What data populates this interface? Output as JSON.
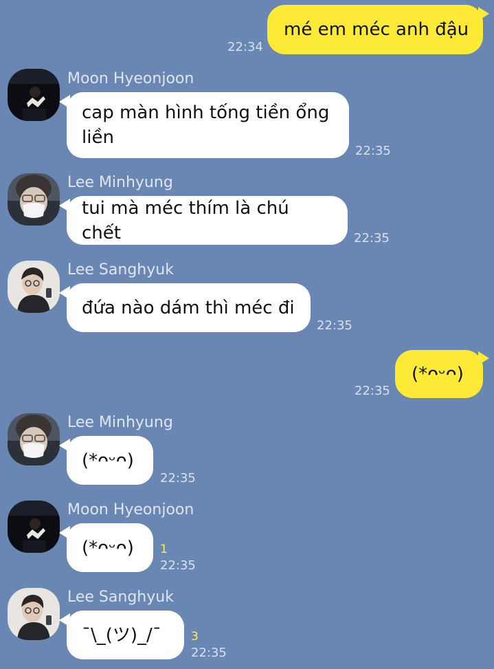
{
  "messages": [
    {
      "direction": "out",
      "text": "mé em méc anh đậu",
      "time": "22:34"
    },
    {
      "direction": "in",
      "sender": "Moon Hyeonjoon",
      "avatar": "avatar-moon-hyeonjoon",
      "text": "cap màn hình tống tiền ổng liền",
      "time": "22:35"
    },
    {
      "direction": "in",
      "sender": "Lee Minhyung",
      "avatar": "avatar-lee-minhyung",
      "text": "tui mà méc thím là chú chết",
      "time": "22:35"
    },
    {
      "direction": "in",
      "sender": "Lee Sanghyuk",
      "avatar": "avatar-lee-sanghyuk",
      "text": "đứa nào dám thì méc đi",
      "time": "22:35"
    },
    {
      "direction": "out",
      "text": "(*ᴖᵕᴖ)",
      "time": "22:35"
    },
    {
      "direction": "in",
      "sender": "Lee Minhyung",
      "avatar": "avatar-lee-minhyung",
      "text": "(*ᴖᵕᴖ)",
      "time": "22:35"
    },
    {
      "direction": "in",
      "sender": "Moon Hyeonjoon",
      "avatar": "avatar-moon-hyeonjoon",
      "text": "(*ᴖᵕᴖ)",
      "time": "22:35",
      "unread": "1"
    },
    {
      "direction": "in",
      "sender": "Lee Sanghyuk",
      "avatar": "avatar-lee-sanghyuk",
      "text": "¯\\_(ツ)_/¯",
      "time": "22:35",
      "unread": "3"
    }
  ],
  "colors": {
    "background": "#6a87b3",
    "outgoing_bubble": "#fdea36",
    "incoming_bubble": "#ffffff",
    "unread_count": "#fff04a"
  }
}
